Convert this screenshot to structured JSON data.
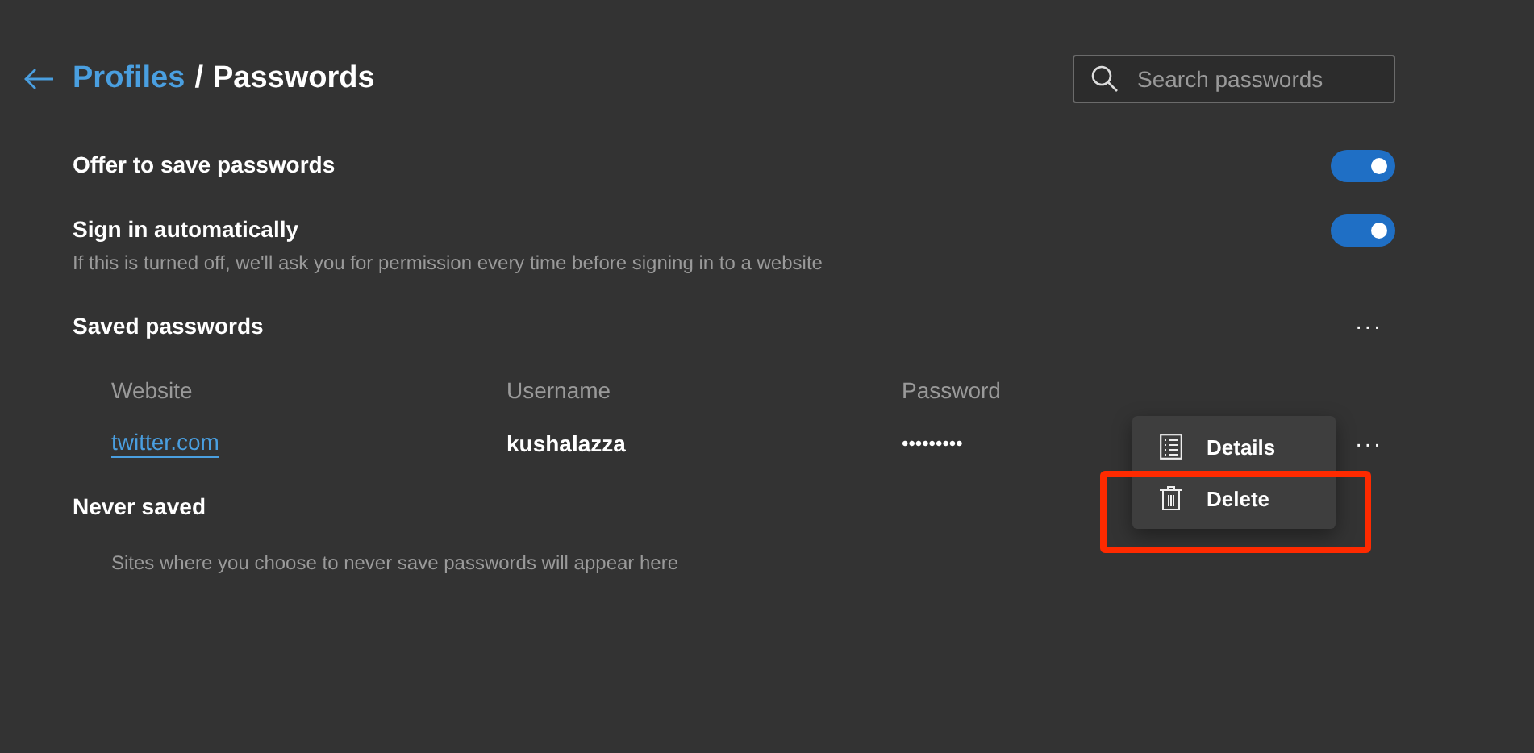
{
  "header": {
    "breadcrumb_link": "Profiles",
    "separator": "/",
    "title": "Passwords"
  },
  "search": {
    "placeholder": "Search passwords"
  },
  "settings": [
    {
      "label": "Offer to save passwords",
      "on": true
    },
    {
      "label": "Sign in automatically",
      "description": "If this is turned off, we'll ask you for permission every time before signing in to a website",
      "on": true
    }
  ],
  "saved_passwords": {
    "title": "Saved passwords",
    "more": "···",
    "columns": [
      "Website",
      "Username",
      "Password"
    ],
    "rows": [
      {
        "website": "twitter.com",
        "username": "kushalazza",
        "password": "•••••••••",
        "more": "···"
      }
    ]
  },
  "context_menu": [
    {
      "kind": "details",
      "label": "Details"
    },
    {
      "kind": "delete",
      "label": "Delete",
      "highlighted": true
    }
  ],
  "never_saved": {
    "title": "Never saved",
    "description": "Sites where you choose to never save passwords will appear here"
  }
}
